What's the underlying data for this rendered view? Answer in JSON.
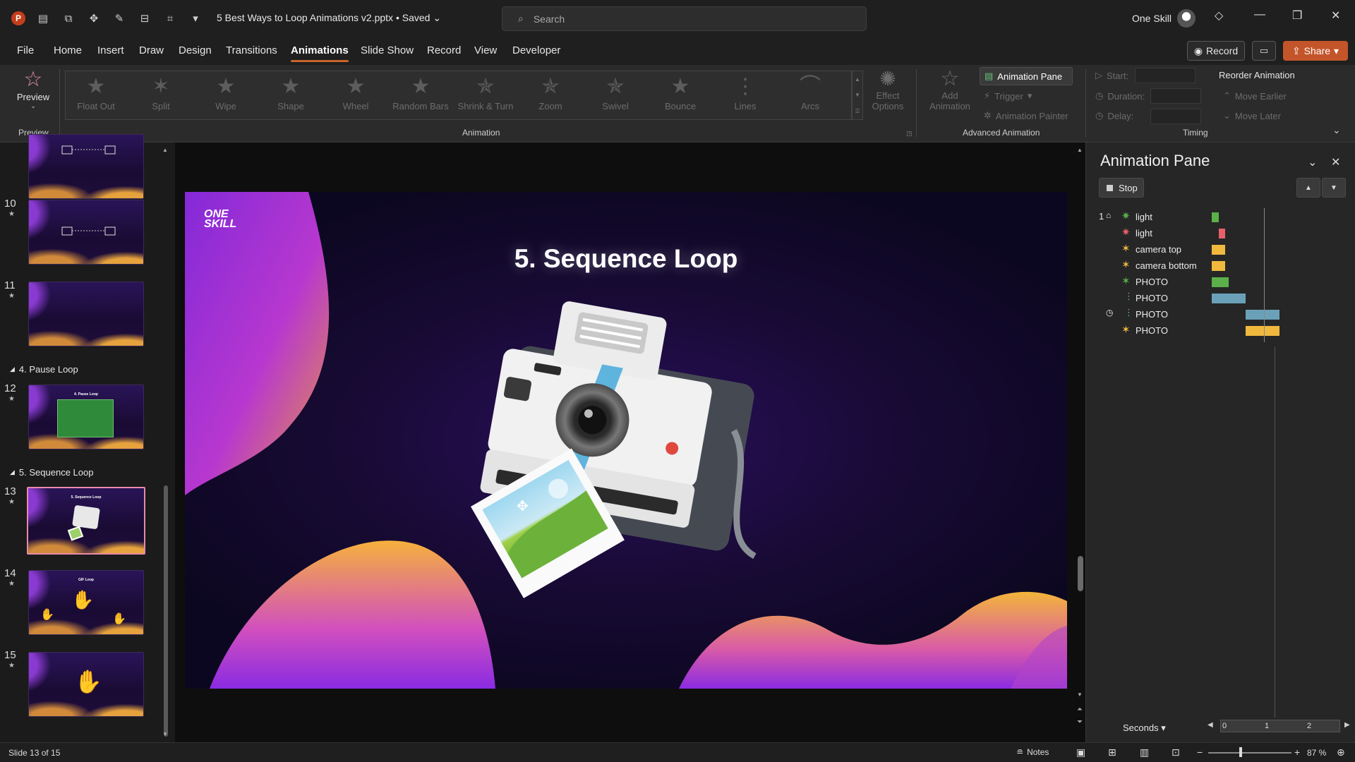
{
  "titlebar": {
    "app_icon": "P",
    "doc_title": "5 Best Ways to Loop Animations v2.pptx • Saved",
    "search_placeholder": "Search",
    "user_name": "One Skill"
  },
  "menu": {
    "tabs": [
      "File",
      "Home",
      "Insert",
      "Draw",
      "Design",
      "Transitions",
      "Animations",
      "Slide Show",
      "Record",
      "View",
      "Developer"
    ],
    "active_tab": "Animations",
    "record_label": "Record",
    "share_label": "Share"
  },
  "ribbon": {
    "preview_label": "Preview",
    "preview_group": "Preview",
    "animation_group": "Animation",
    "advanced_group": "Advanced Animation",
    "timing_group": "Timing",
    "animations": [
      "Float Out",
      "Split",
      "Wipe",
      "Shape",
      "Wheel",
      "Random Bars",
      "Shrink & Turn",
      "Zoom",
      "Swivel",
      "Bounce",
      "Lines",
      "Arcs"
    ],
    "effect_options": "Effect Options",
    "add_animation": "Add Animation",
    "animation_pane": "Animation Pane",
    "trigger": "Trigger",
    "animation_painter": "Animation Painter",
    "start_label": "Start:",
    "duration_label": "Duration:",
    "delay_label": "Delay:",
    "reorder_title": "Reorder Animation",
    "move_earlier": "Move Earlier",
    "move_later": "Move Later"
  },
  "thumbnails": {
    "items": [
      {
        "num": "10"
      },
      {
        "num": "11"
      },
      {
        "num": "12",
        "title": "4. Pause Loop"
      },
      {
        "num": "13",
        "title": "5. Sequence Loop"
      },
      {
        "num": "14",
        "title": "GIF Loop"
      },
      {
        "num": "15"
      }
    ],
    "sections": [
      "4. Pause Loop",
      "5. Sequence Loop"
    ]
  },
  "slide": {
    "title": "5. Sequence Loop",
    "logo_line1": "ONE",
    "logo_line2": "SKILL"
  },
  "animation_pane": {
    "title": "Animation Pane",
    "stop_label": "Stop",
    "seconds_label": "Seconds",
    "ruler_ticks": [
      "0",
      "1",
      "2"
    ],
    "rows": [
      {
        "seq": "1",
        "name": "light",
        "color": "#5bb04a",
        "bar_start": 0.0,
        "bar_len": 0.2
      },
      {
        "seq": "",
        "name": "light",
        "color": "#e8606a",
        "bar_start": 0.2,
        "bar_len": 0.2
      },
      {
        "seq": "",
        "name": "camera top",
        "color": "#f0b93e",
        "bar_start": 0.0,
        "bar_len": 0.4
      },
      {
        "seq": "",
        "name": "camera bottom",
        "color": "#f0b93e",
        "bar_start": 0.0,
        "bar_len": 0.4
      },
      {
        "seq": "",
        "name": "PHOTO",
        "color": "#5bb04a",
        "bar_start": 0.0,
        "bar_len": 0.5
      },
      {
        "seq": "",
        "name": "PHOTO",
        "color": "#6aa1b8",
        "bar_start": 0.0,
        "bar_len": 1.0
      },
      {
        "seq": "",
        "name": "PHOTO",
        "color": "#6aa1b8",
        "bar_start": 1.0,
        "bar_len": 1.0
      },
      {
        "seq": "",
        "name": "PHOTO",
        "color": "#f0b93e",
        "bar_start": 1.0,
        "bar_len": 1.0
      }
    ]
  },
  "status": {
    "slide_info": "Slide 13 of 15",
    "notes_label": "Notes",
    "zoom": "87 %"
  }
}
